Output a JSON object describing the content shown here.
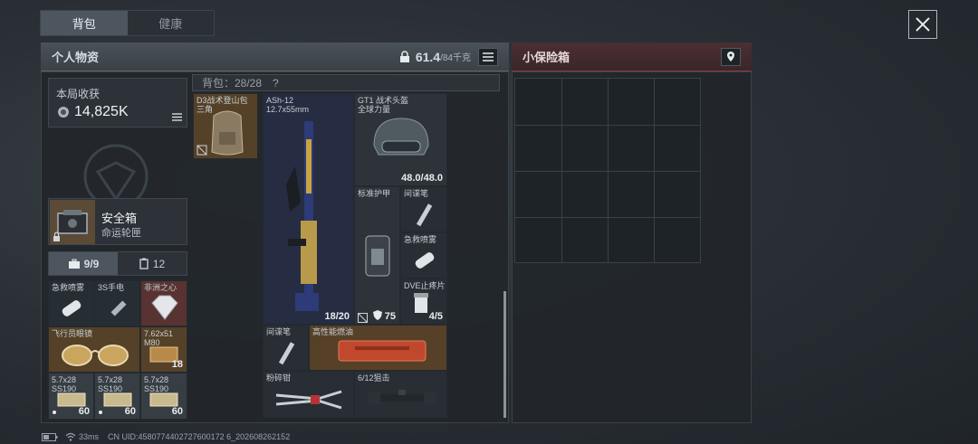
{
  "tabs": [
    {
      "label": "背包",
      "active": true
    },
    {
      "label": "健康",
      "active": false
    }
  ],
  "personal": {
    "title": "个人物资",
    "weight": "61.4",
    "weight_max": "/84千克"
  },
  "vault": {
    "title": "小保险箱"
  },
  "earnings": {
    "label": "本局收获",
    "value": "14,825K"
  },
  "safebox": {
    "name": "安全箱",
    "sub": "命运轮匣"
  },
  "inventory_tabs": [
    {
      "label": "9/9",
      "icon": "briefcase-icon"
    },
    {
      "label": "12",
      "icon": "clipboard-icon"
    }
  ],
  "pouch": {
    "items": [
      {
        "label": "急救喷雾",
        "count": ""
      },
      {
        "label": "3S手电",
        "count": ""
      },
      {
        "label": "非洲之心",
        "count": ""
      },
      {
        "label": "飞行员眼镜",
        "count": ""
      },
      {
        "label": "7.62x51\nM80",
        "count": "18"
      },
      {
        "label": "5.7x28\nSS190",
        "count": "60"
      },
      {
        "label": "5.7x28\nSS190",
        "count": "60"
      },
      {
        "label": "5.7x28\nSS190",
        "count": "60"
      }
    ]
  },
  "backpack": {
    "header": "背包：28/28",
    "help": "?",
    "bag_label": "D3战术登山包\n三角",
    "weapon": {
      "name": "ASh-12",
      "caliber": "12.7x55mm",
      "ammo": "18/20"
    },
    "helmet": {
      "name": "GT1 战术头盔",
      "sub": "全球力量",
      "durability": "48.0/48.0"
    },
    "armor": {
      "name": "标准护甲",
      "durability": "75"
    },
    "items": [
      {
        "label": "间谍笔",
        "count": ""
      },
      {
        "label": "急救喷雾",
        "count": ""
      },
      {
        "label": "DVE止疼片",
        "count": "4/5"
      },
      {
        "label": "间谍笔",
        "count": ""
      },
      {
        "label": "高性能燃油",
        "count": ""
      },
      {
        "label": "粉碎钳",
        "count": ""
      },
      {
        "label": "6/12狙击",
        "count": ""
      }
    ]
  },
  "status": {
    "ping": "33ms",
    "uid": "CN UID:4580774402727600172 6_202608262152"
  },
  "colors": {
    "vault_accent": "#8a3a44",
    "header_bg": "#4a5259",
    "rare_red": "#5c3432",
    "rare_gold": "#584228"
  }
}
